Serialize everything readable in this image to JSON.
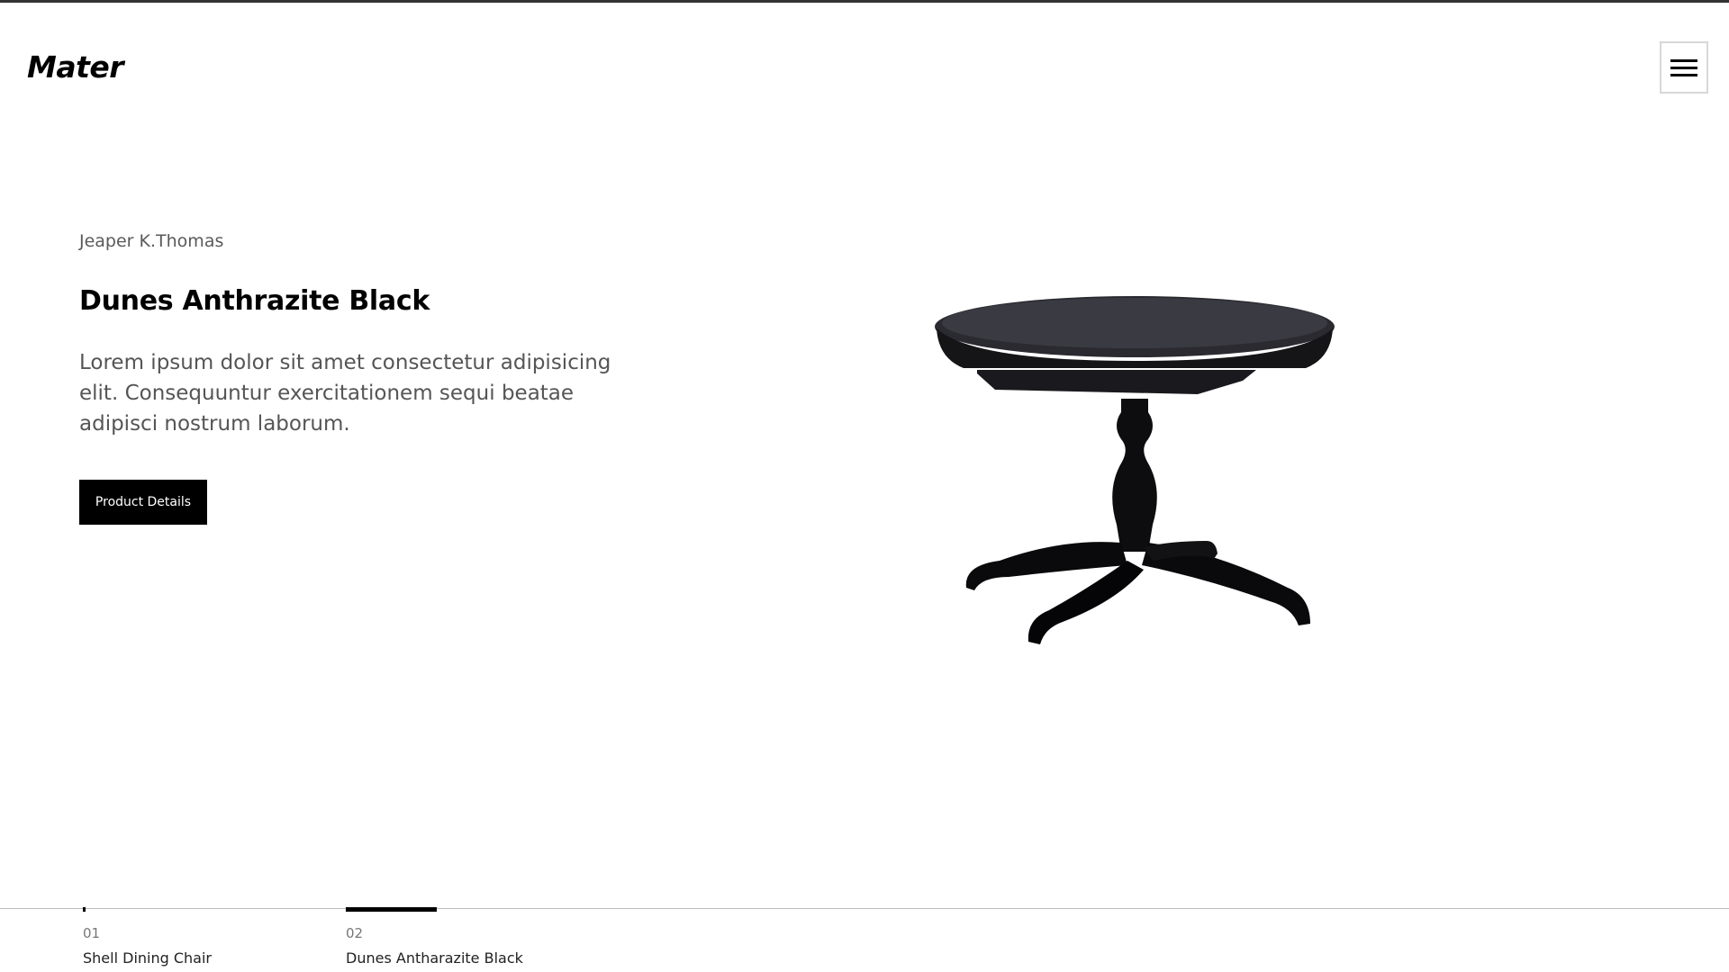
{
  "header": {
    "logo": "Mater",
    "menu_icon": "hamburger-menu-icon"
  },
  "hero": {
    "author": "Jeaper K.Thomas",
    "title": "Dunes Anthrazite Black",
    "description": "Lorem ipsum dolor sit amet consectetur adipisicing elit. Consequuntur exercitationem sequi beatae adipisci nostrum laborum.",
    "cta_label": "Product Details",
    "image_alt": "black round pedestal dining table"
  },
  "slides": [
    {
      "number": "01",
      "name": "Shell Dining Chair",
      "progress": 0.02
    },
    {
      "number": "02",
      "name": "Dunes Antharazite Black",
      "progress": 1.0
    }
  ],
  "colors": {
    "accent": "#000000",
    "text_muted": "#555555",
    "background": "#ffffff"
  }
}
